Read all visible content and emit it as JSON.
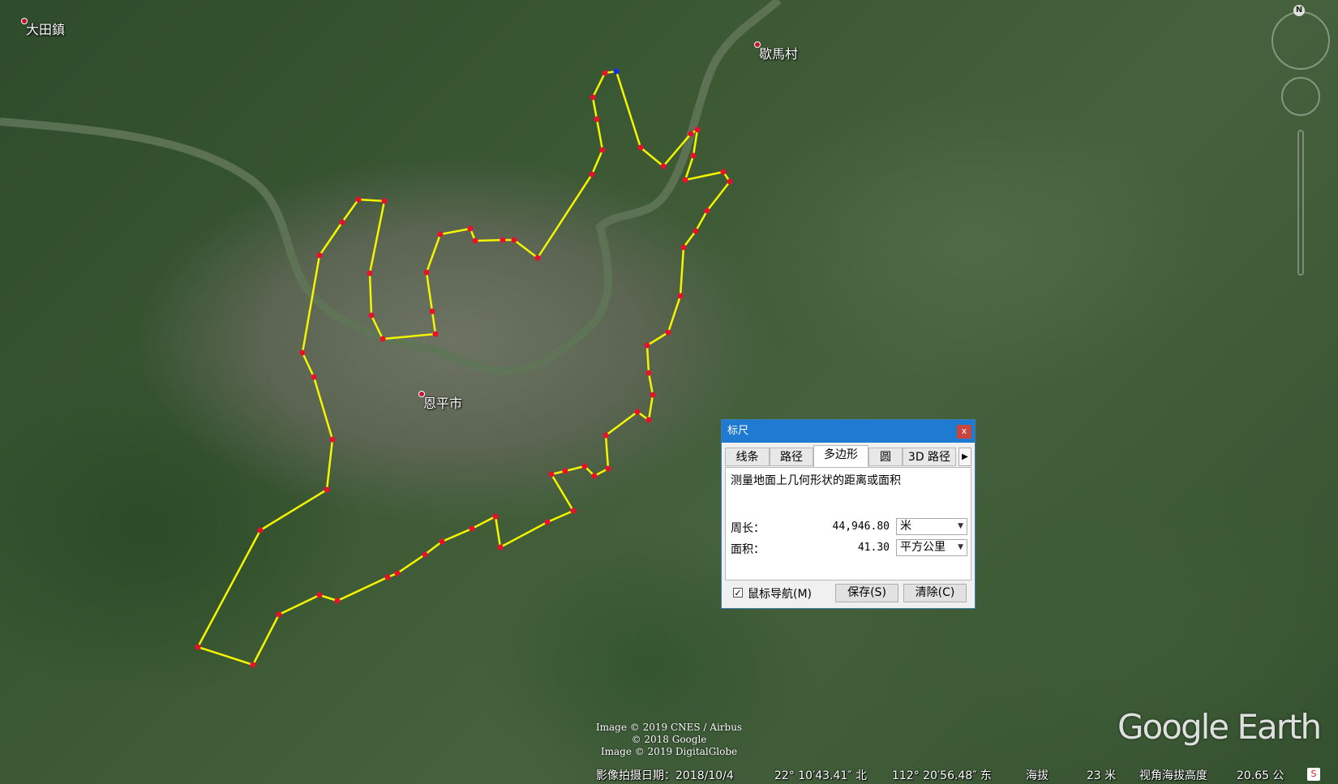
{
  "map": {
    "places": [
      {
        "name": "大田鎮"
      },
      {
        "name": "歇馬村"
      },
      {
        "name": "恩平市"
      }
    ],
    "measured_polygon_color": "#f5f500",
    "vertex_color": "#e8102a",
    "start_vertex_color": "#1030e8"
  },
  "compass": {
    "north_label": "N"
  },
  "ruler_dialog": {
    "title": "标尺",
    "close_label": "x",
    "tabs": [
      "线条",
      "路径",
      "多边形",
      "圆",
      "3D 路径"
    ],
    "active_tab": "多边形",
    "description": "测量地面上几何形状的距离或面积",
    "perimeter_label": "周长：",
    "perimeter_value": "44,946.80",
    "perimeter_unit": "米",
    "area_label": "面积：",
    "area_value": "41.30",
    "area_unit": "平方公里",
    "mouse_nav_label": "鼠标导航(M)",
    "mouse_nav_checked": true,
    "save_label": "保存(S)",
    "clear_label": "清除(C)"
  },
  "attribution": {
    "line1": "Image © 2019 CNES / Airbus",
    "line2": "© 2018 Google",
    "line3": "Image © 2019 DigitalGlobe"
  },
  "status_bar": {
    "imagery_date": "影像拍摄日期：2018/10/4",
    "latitude": "22° 10′43.41″ 北",
    "longitude": "112° 20′56.48″ 东",
    "elevation_label": "海拔",
    "elevation_value": "23 米",
    "eye_alt_label": "视角海拔高度",
    "eye_alt_value": "20.65 公"
  },
  "logo": {
    "text": "Google Earth"
  }
}
